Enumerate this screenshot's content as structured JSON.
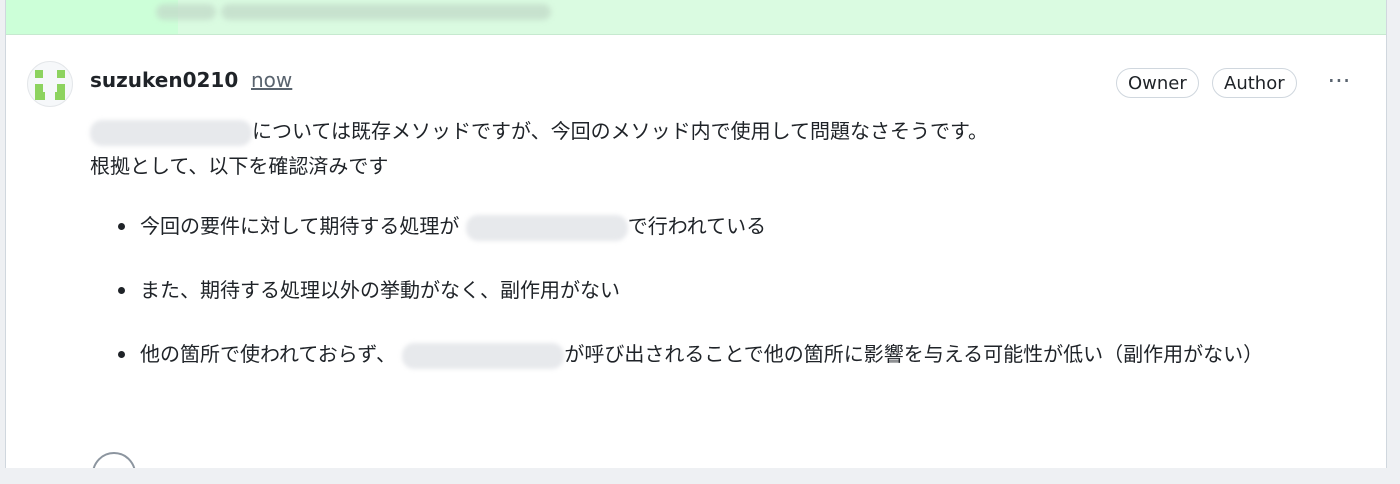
{
  "comment": {
    "author": "suzuken0210",
    "time": "now",
    "badges": [
      "Owner",
      "Author"
    ],
    "menu_icon": "kebab-horizontal-icon",
    "avatar_icon": "identicon-avatar",
    "line1_after_redaction": "については既存メソッドですが、今回のメソッド内で使用して問題なさそうです。",
    "line2": "根拠として、以下を確認済みです",
    "bullets": {
      "b1_before": "今回の要件に対して期待する処理が",
      "b1_after": "で行われている",
      "b2": "また、期待する処理以外の挙動がなく、副作用がない",
      "b3_before": "他の箇所で使われておらず、",
      "b3_after": "が呼び出されることで他の箇所に影響を与える可能性が低い（副作用がない）"
    },
    "reaction_icon": "smiley-icon"
  },
  "colors": {
    "diff_added_bg": "#dafbe1",
    "badge_border": "#d0d7de",
    "text": "#1f2328",
    "muted": "#59636e"
  }
}
